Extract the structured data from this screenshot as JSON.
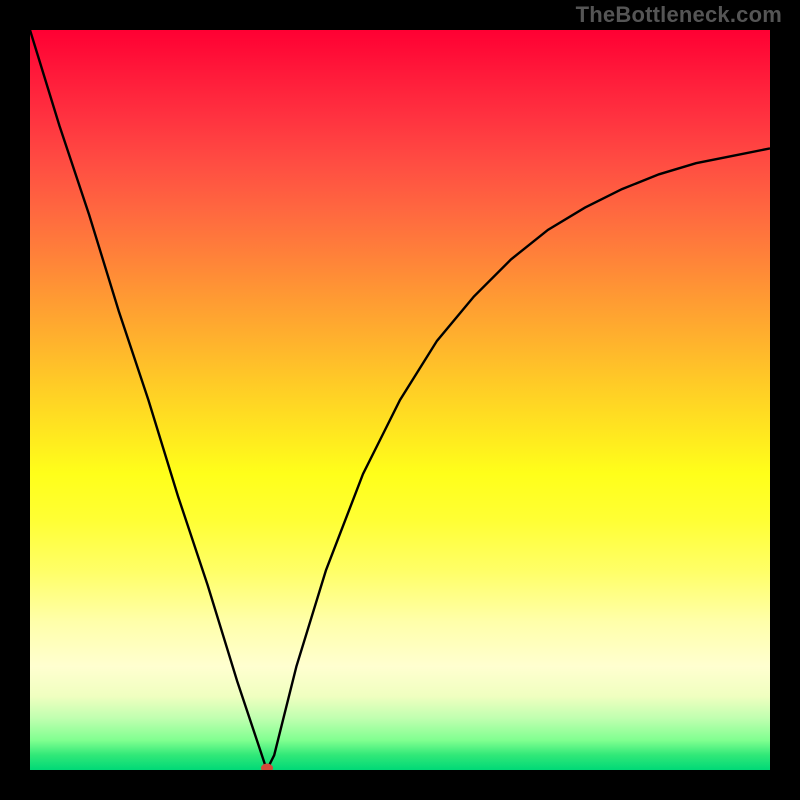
{
  "watermark": "TheBottleneck.com",
  "chart_data": {
    "type": "line",
    "title": "",
    "xlabel": "",
    "ylabel": "",
    "xlim": [
      0,
      100
    ],
    "ylim": [
      0,
      100
    ],
    "grid": false,
    "note": "Values are relative (0–100) since the original axes are unlabeled; y represents bottleneck severity (0 = none / green, 100 = severe / red). The curve dips to ~0 at the balance point then asymptotically rises.",
    "series": [
      {
        "name": "bottleneck-curve",
        "x": [
          0,
          4,
          8,
          12,
          16,
          20,
          24,
          28,
          31,
          32,
          33,
          34,
          36,
          40,
          45,
          50,
          55,
          60,
          65,
          70,
          75,
          80,
          85,
          90,
          95,
          100
        ],
        "y": [
          100,
          87,
          75,
          62,
          50,
          37,
          25,
          12,
          3,
          0,
          2,
          6,
          14,
          27,
          40,
          50,
          58,
          64,
          69,
          73,
          76,
          78.5,
          80.5,
          82,
          83,
          84
        ]
      }
    ],
    "minimum_point": {
      "x": 32,
      "y": 0
    },
    "marker_color": "#d44a3a",
    "curve_color": "#000000",
    "background_gradient": {
      "top": "#ff0033",
      "mid": "#ffff33",
      "bottom": "#00d977"
    }
  }
}
